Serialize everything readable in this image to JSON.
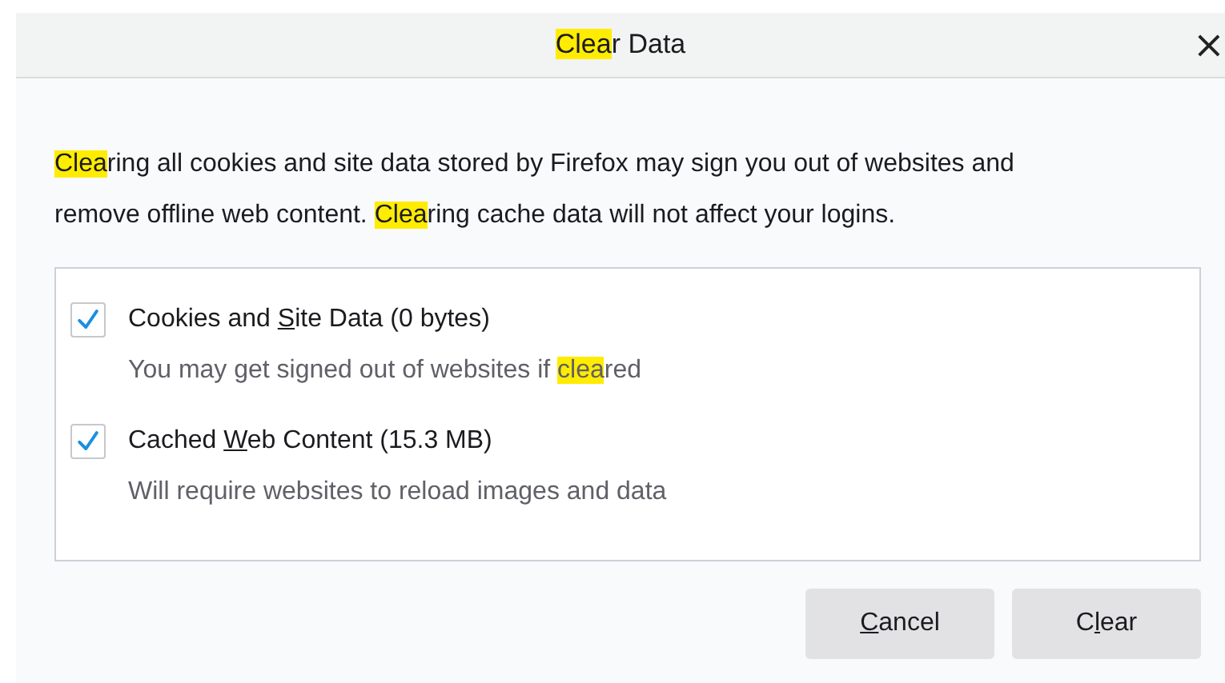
{
  "dialog": {
    "title": [
      {
        "text": "Clea",
        "highlighted": true
      },
      {
        "text": "r Data",
        "highlighted": false
      }
    ],
    "close": "×"
  },
  "message": [
    {
      "text": "Clea",
      "highlighted": true
    },
    {
      "text": "ring all cookies and site data stored by Firefox may sign you out of websites and remove offline web content. ",
      "highlighted": false
    },
    {
      "text": "Clea",
      "highlighted": true
    },
    {
      "text": "ring cache data will not affect your logins.",
      "highlighted": false
    }
  ],
  "options": [
    {
      "checked": true,
      "label": [
        {
          "text": "Cookies and ",
          "underlined": false
        },
        {
          "text": "S",
          "underlined": true
        },
        {
          "text": "ite Data (0 bytes)",
          "underlined": false
        }
      ],
      "description": [
        {
          "text": "You may get signed out of websites if ",
          "highlighted": false
        },
        {
          "text": "clea",
          "highlighted": true
        },
        {
          "text": "red",
          "highlighted": false
        }
      ]
    },
    {
      "checked": true,
      "label": [
        {
          "text": "Cached ",
          "underlined": false
        },
        {
          "text": "W",
          "underlined": true
        },
        {
          "text": "eb Content (15.3 MB)",
          "underlined": false
        }
      ],
      "description": [
        {
          "text": "Will require websites to reload images and data",
          "highlighted": false
        }
      ]
    }
  ],
  "buttons": [
    {
      "label": [
        {
          "text": "C",
          "underlined": true
        },
        {
          "text": "ancel",
          "underlined": false
        }
      ]
    },
    {
      "label": [
        {
          "text": "C",
          "underlined": false
        },
        {
          "text": "l",
          "underlined": true
        },
        {
          "text": "ear",
          "underlined": false
        }
      ]
    }
  ]
}
